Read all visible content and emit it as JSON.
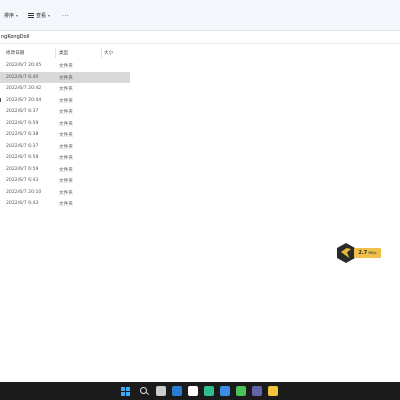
{
  "toolbar": {
    "sort_label": "排序",
    "view_label": "查看",
    "more_label": "···"
  },
  "address": {
    "path": "ngKongDoll"
  },
  "columns": {
    "date": "修改日期",
    "type": "类型",
    "size": "大小"
  },
  "files": [
    {
      "date": "2022/6/7 20:45",
      "type": "文件夹",
      "selected": false
    },
    {
      "date": "2022/6/7 6:40",
      "type": "文件夹",
      "selected": true
    },
    {
      "date": "2022/6/7 20:42",
      "type": "文件夹",
      "selected": false
    },
    {
      "date": "2022/6/7 20:44",
      "type": "文件夹",
      "selected": false
    },
    {
      "date": "2022/6/7 6:37",
      "type": "文件夹",
      "selected": false
    },
    {
      "date": "2022/6/7 6:59",
      "type": "文件夹",
      "selected": false
    },
    {
      "date": "2022/6/7 6:38",
      "type": "文件夹",
      "selected": false
    },
    {
      "date": "2022/6/7 6:37",
      "type": "文件夹",
      "selected": false
    },
    {
      "date": "2022/6/7 6:58",
      "type": "文件夹",
      "selected": false
    },
    {
      "date": "2022/6/7 6:59",
      "type": "文件夹",
      "selected": false
    },
    {
      "date": "2022/6/7 6:43",
      "type": "文件夹",
      "selected": false
    },
    {
      "date": "2022/6/7 20:10",
      "type": "文件夹",
      "selected": false
    },
    {
      "date": "2022/6/7 6:43",
      "type": "文件夹",
      "selected": false
    }
  ],
  "speed_widget": {
    "value": "2.7",
    "unit": "MB/s",
    "accent": "#efc14a"
  },
  "taskbar": {
    "icons": [
      {
        "name": "start-icon",
        "color": "#3fa9f5"
      },
      {
        "name": "search-icon",
        "color": "#dddddd"
      },
      {
        "name": "task-view-icon",
        "color": "#cccccc"
      },
      {
        "name": "mail-icon",
        "color": "#2b7cd3"
      },
      {
        "name": "capcut-icon",
        "color": "#ffffff"
      },
      {
        "name": "edge-icon",
        "color": "#2fbf8f"
      },
      {
        "name": "store-icon",
        "color": "#3a8ee6"
      },
      {
        "name": "wechat-icon",
        "color": "#4cc15a"
      },
      {
        "name": "teams-icon",
        "color": "#6264a7"
      },
      {
        "name": "file-explorer-icon",
        "color": "#f3c43a"
      },
      {
        "name": "app-red-icon",
        "color": "#d84a3a"
      },
      {
        "name": "app-dark-icon",
        "color": "#2f2f2f"
      },
      {
        "name": "app-green-icon",
        "color": "#8fbf3a"
      }
    ]
  }
}
